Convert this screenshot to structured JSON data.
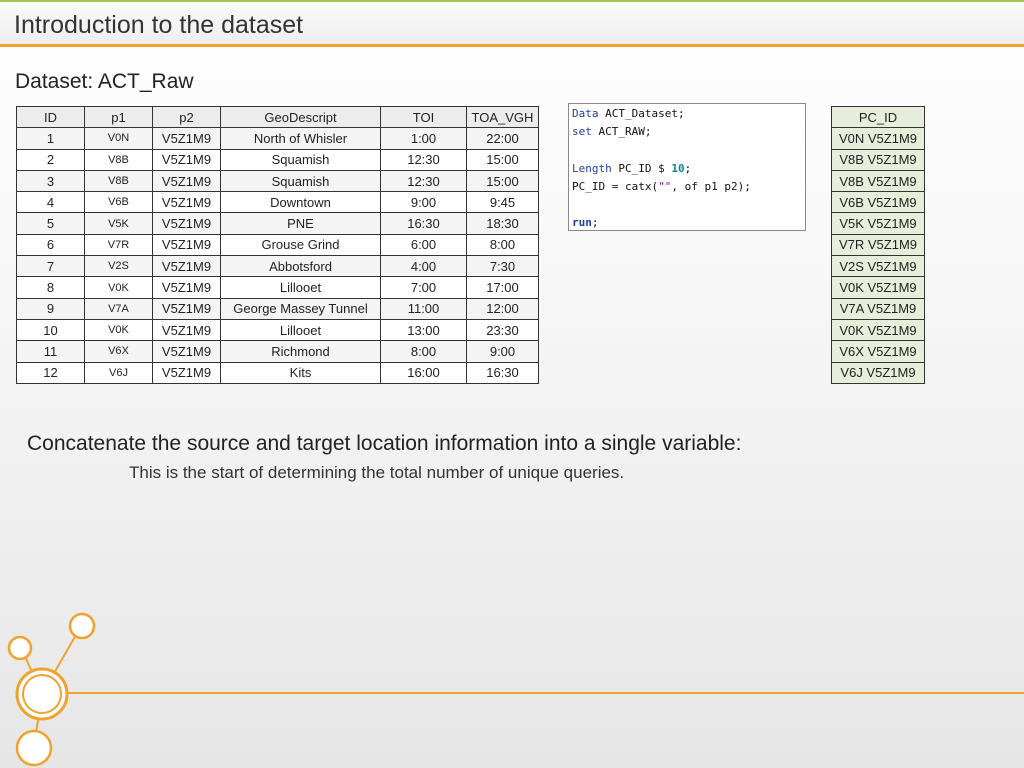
{
  "slide": {
    "title": "Introduction to the dataset",
    "subtitle": "Dataset: ACT_Raw"
  },
  "raw_table": {
    "headers": [
      "ID",
      "p1",
      "p2",
      "GeoDescript",
      "TOI",
      "TOA_VGH"
    ],
    "rows": [
      [
        "1",
        "V0N",
        "V5Z1M9",
        "North of Whisler",
        "1:00",
        "22:00"
      ],
      [
        "2",
        "V8B",
        "V5Z1M9",
        "Squamish",
        "12:30",
        "15:00"
      ],
      [
        "3",
        "V8B",
        "V5Z1M9",
        "Squamish",
        "12:30",
        "15:00"
      ],
      [
        "4",
        "V6B",
        "V5Z1M9",
        "Downtown",
        "9:00",
        "9:45"
      ],
      [
        "5",
        "V5K",
        "V5Z1M9",
        "PNE",
        "16:30",
        "18:30"
      ],
      [
        "6",
        "V7R",
        "V5Z1M9",
        "Grouse Grind",
        "6:00",
        "8:00"
      ],
      [
        "7",
        "V2S",
        "V5Z1M9",
        "Abbotsford",
        "4:00",
        "7:30"
      ],
      [
        "8",
        "V0K",
        "V5Z1M9",
        "Lillooet",
        "7:00",
        "17:00"
      ],
      [
        "9",
        "V7A",
        "V5Z1M9",
        "George Massey Tunnel",
        "11:00",
        "12:00"
      ],
      [
        "10",
        "V0K",
        "V5Z1M9",
        "Lillooet",
        "13:00",
        "23:30"
      ],
      [
        "11",
        "V6X",
        "V5Z1M9",
        "Richmond",
        "8:00",
        "9:00"
      ],
      [
        "12",
        "V6J",
        "V5Z1M9",
        "Kits",
        "16:00",
        "16:30"
      ]
    ]
  },
  "code": {
    "line1_kw": "Data",
    "line1_rest": " ACT_Dataset;",
    "line2_kw": "set",
    "line2_rest": " ACT_RAW;",
    "line3_kw": "Length",
    "line3_mid": " PC_ID $ ",
    "line3_num": "10",
    "line3_end": ";",
    "line4_pre": "PC_ID = catx(",
    "line4_str": "\"\"",
    "line4_end": ", of p1 p2);",
    "line5_kw": "run",
    "line5_end": ";"
  },
  "pcid_table": {
    "header": "PC_ID",
    "values": [
      "V0N V5Z1M9",
      "V8B V5Z1M9",
      "V8B V5Z1M9",
      "V6B V5Z1M9",
      "V5K V5Z1M9",
      "V7R V5Z1M9",
      "V2S V5Z1M9",
      "V0K V5Z1M9",
      "V7A V5Z1M9",
      "V0K V5Z1M9",
      "V6X V5Z1M9",
      "V6J V5Z1M9"
    ]
  },
  "text": {
    "concat_title": "Concatenate the source and target location information into a single variable:",
    "concat_sub": "This is the start of determining the total number of unique queries."
  },
  "colors": {
    "accent_orange": "#f0a22e",
    "accent_green": "#a4c45a",
    "pcid_fill": "#e6eedb"
  }
}
